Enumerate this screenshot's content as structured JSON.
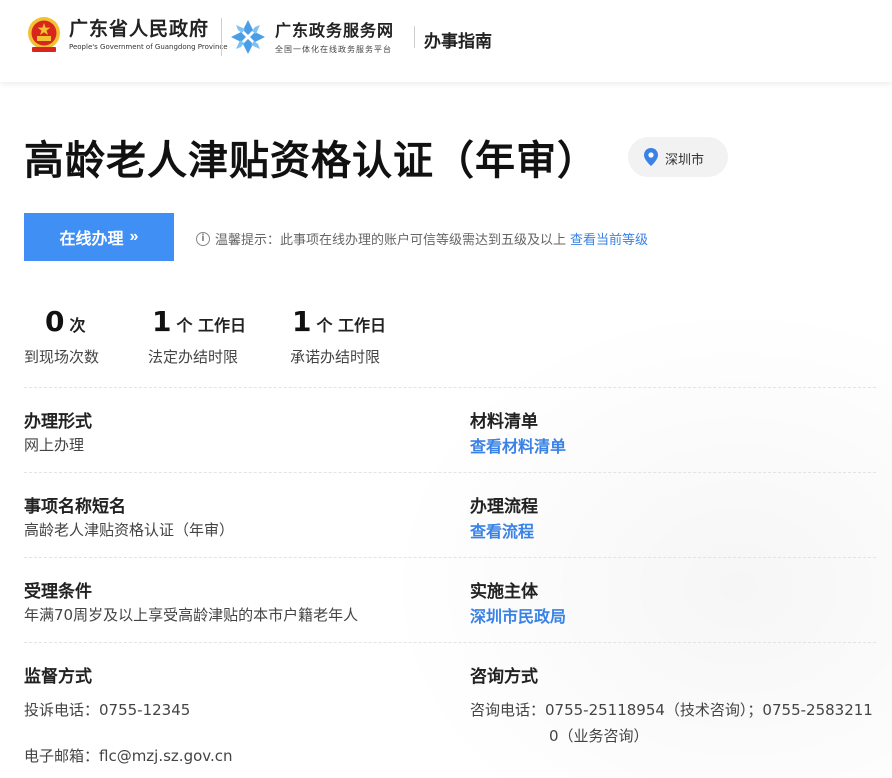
{
  "header": {
    "gov_name": "广东省人民政府",
    "gov_name_en": "People's Government of Guangdong Province",
    "service_name": "广东政务服务网",
    "service_subtitle": "全国一体化在线政务服务平台",
    "section": "办事指南"
  },
  "title": "高龄老人津贴资格认证（年审）",
  "city": "深圳市",
  "online_button": {
    "label": "在线办理",
    "chevron": "»"
  },
  "tip": {
    "text": "温馨提示：此事项在线办理的账户可信等级需达到五级及以上",
    "link": "查看当前等级"
  },
  "stats": [
    {
      "number": "0",
      "unit": "次",
      "label": "到现场次数"
    },
    {
      "number": "1",
      "unit": "个 工作日",
      "label": "法定办结时限"
    },
    {
      "number": "1",
      "unit": "个 工作日",
      "label": "承诺办结时限"
    }
  ],
  "fields": {
    "handling_form": {
      "title": "办理形式",
      "value": "网上办理"
    },
    "materials": {
      "title": "材料清单",
      "link": "查看材料清单"
    },
    "short_name": {
      "title": "事项名称短名",
      "value": "高龄老人津贴资格认证（年审）"
    },
    "process": {
      "title": "办理流程",
      "link": "查看流程"
    },
    "conditions": {
      "title": "受理条件",
      "value": "年满70周岁及以上享受高龄津贴的本市户籍老年人"
    },
    "agency": {
      "title": "实施主体",
      "link": "深圳市民政局"
    },
    "supervision": {
      "title": "监督方式",
      "phone": "投诉电话：0755-12345",
      "email": "电子邮箱：flc@mzj.sz.gov.cn"
    },
    "consult": {
      "title": "咨询方式",
      "line1": "咨询电话：0755-25118954（技术咨询）；0755-2583211",
      "line2": "0（业务咨询）"
    }
  },
  "colors": {
    "primary_blue": "#3f8ff5",
    "link_blue": "#3a82e5",
    "emblem_red": "#d9261c",
    "emblem_gold": "#f2c230"
  },
  "icons": [
    "national-emblem-icon",
    "service-logo-icon",
    "location-pin-icon",
    "info-icon"
  ]
}
